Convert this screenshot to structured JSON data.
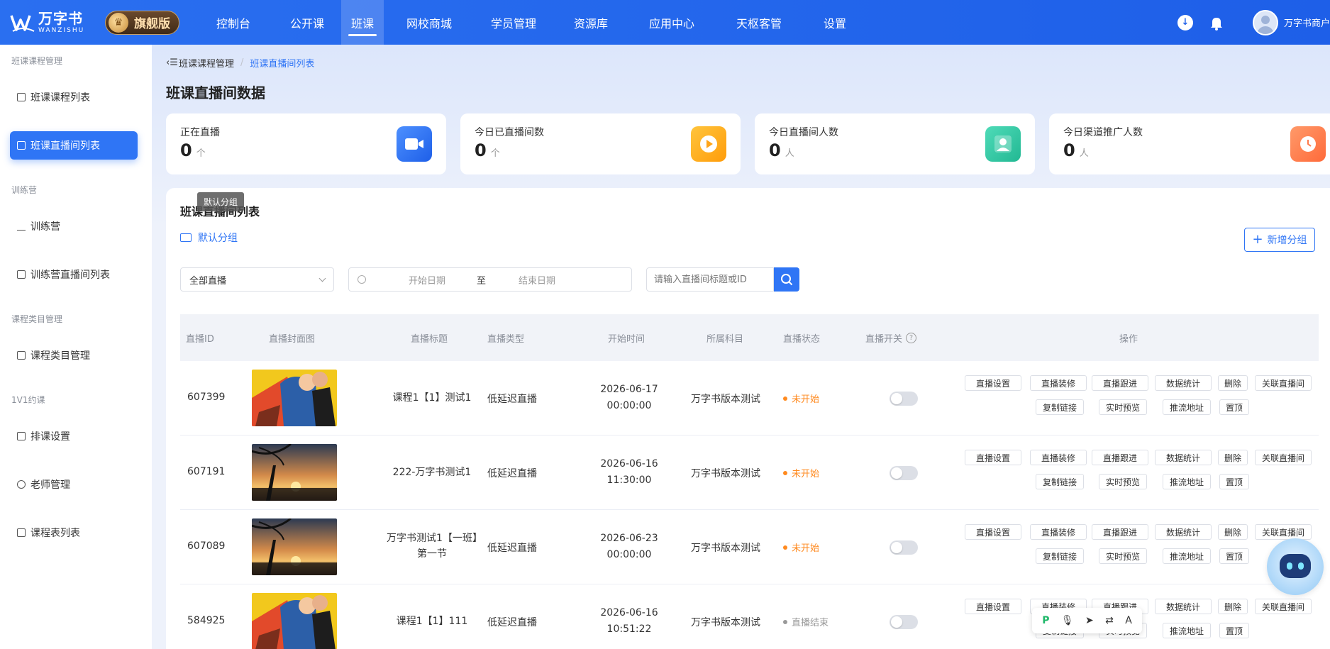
{
  "brand": {
    "name_cn": "万字书",
    "name_en": "WANZISHU",
    "edition": "旗舰版"
  },
  "nav": {
    "items": [
      {
        "label": "控制台"
      },
      {
        "label": "公开课"
      },
      {
        "label": "班课"
      },
      {
        "label": "网校商城"
      },
      {
        "label": "学员管理"
      },
      {
        "label": "资源库"
      },
      {
        "label": "应用中心"
      },
      {
        "label": "天枢客管"
      },
      {
        "label": "设置"
      }
    ],
    "active": "班课"
  },
  "user": {
    "name": "万字书商户"
  },
  "sidebar": {
    "groups": [
      {
        "title": "班课课程管理",
        "items": [
          "班课课程列表",
          "班课直播间列表"
        ]
      },
      {
        "title": "训练营",
        "items": [
          "训练营",
          "训练营直播间列表"
        ]
      },
      {
        "title": "课程类目管理",
        "items": [
          "课程类目管理"
        ]
      },
      {
        "title": "1V1约课",
        "items": [
          "排课设置",
          "老师管理",
          "课程表列表"
        ]
      }
    ],
    "active": "班课直播间列表"
  },
  "breadcrumb": {
    "parent": "班课课程管理",
    "separator": "/",
    "current": "班课直播间列表"
  },
  "page": {
    "title": "班课直播间数据"
  },
  "stats": [
    {
      "label": "正在直播",
      "value": "0",
      "unit": "个",
      "icon": "video-camera-icon",
      "color": "#2f75f5"
    },
    {
      "label": "今日已直播间数",
      "value": "0",
      "unit": "个",
      "icon": "play-icon",
      "color": "#ffb11b"
    },
    {
      "label": "今日直播间人数",
      "value": "0",
      "unit": "人",
      "icon": "user-icon",
      "color": "#2fc7a3"
    },
    {
      "label": "今日渠道推广人数",
      "value": "0",
      "unit": "人",
      "icon": "clock-icon",
      "color": "#ff7a4a"
    }
  ],
  "list": {
    "title": "班课直播间列表",
    "tooltip": "默认分组",
    "group_label": "默认分组",
    "add_group_label": "新增分组",
    "filter_select": "全部直播",
    "date_start_placeholder": "开始日期",
    "date_separator": "至",
    "date_end_placeholder": "结束日期",
    "search_placeholder": "请输入直播间标题或ID"
  },
  "table": {
    "columns": [
      "直播ID",
      "直播封面图",
      "直播标题",
      "直播类型",
      "开始时间",
      "所属科目",
      "直播状态",
      "直播开关",
      "操作"
    ],
    "ops_row1": [
      "直播设置",
      "直播装修",
      "直播跟进",
      "数据统计",
      "删除",
      "关联直播间"
    ],
    "ops_row2": [
      "复制链接",
      "实时预览",
      "推流地址",
      "置顶"
    ],
    "rows": [
      {
        "id": "607399",
        "cover": "comic",
        "title": "课程1【1】测试1",
        "type": "低延迟直播",
        "time": "2026-06-17 00:00:00",
        "subject": "万字书版本测试",
        "status": "未开始",
        "status_color": "#ff8a1f",
        "switch": "off"
      },
      {
        "id": "607191",
        "cover": "sunset",
        "title": "222-万字书测试1",
        "type": "低延迟直播",
        "time": "2026-06-16 11:30:00",
        "subject": "万字书版本测试",
        "status": "未开始",
        "status_color": "#ff8a1f",
        "switch": "off"
      },
      {
        "id": "607089",
        "cover": "sunset",
        "title": "万字书测试1【一班】第一节",
        "type": "低延迟直播",
        "time": "2026-06-23 00:00:00",
        "subject": "万字书版本测试",
        "status": "未开始",
        "status_color": "#ff8a1f",
        "switch": "off"
      },
      {
        "id": "584925",
        "cover": "comic",
        "title": "课程1【1】111",
        "type": "低延迟直播",
        "time": "2026-06-16 10:51:22",
        "subject": "万字书版本测试",
        "status": "直播结束",
        "status_color": "#999999",
        "switch": "off"
      }
    ]
  }
}
